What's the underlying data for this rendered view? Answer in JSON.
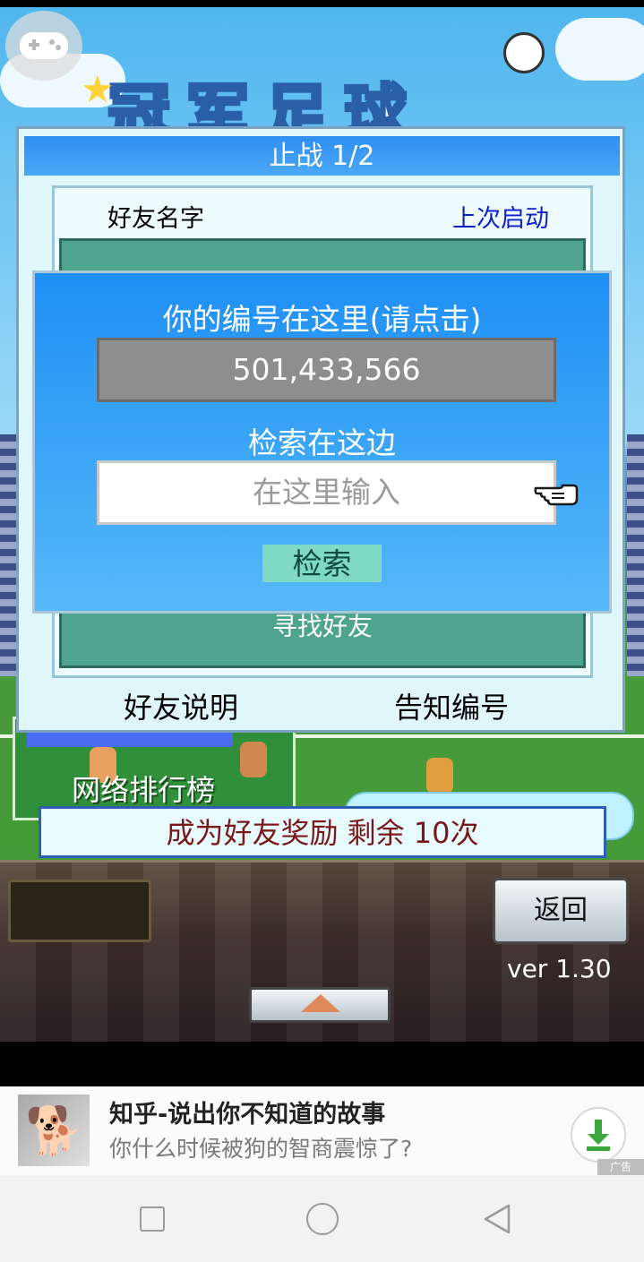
{
  "game": {
    "logo_text": "冠军足球"
  },
  "friend_window": {
    "title": "止战 1/2",
    "col_friend_name": "好友名字",
    "col_last_launch": "上次启动",
    "find_friend": "寻找好友",
    "friend_help": "好友说明",
    "notify_id": "告知编号"
  },
  "popup": {
    "your_id_label": "你的编号在这里(请点击)",
    "your_id": "501,433,566",
    "search_label": "检索在这边",
    "search_placeholder": "在这里输入",
    "search_button": "检索"
  },
  "background": {
    "ranking_label": "网络排行榜"
  },
  "reward_banner": "成为好友奖励 剩余 10次",
  "controls": {
    "back_button": "返回",
    "version": "ver 1.30"
  },
  "ad": {
    "title": "知乎-说出你不知道的故事",
    "subtitle": "你什么时候被狗的智商震惊了?",
    "tag": "广告"
  },
  "colors": {
    "popup_blue": "#1f8ff6",
    "panel_teal": "#4fa48e",
    "header_blue": "#2f8ef2",
    "last_launch_blue": "#1020c8",
    "reward_text": "#7a1818",
    "download_green": "#3aa83a"
  },
  "icons": {
    "gamepad": "gamepad-icon",
    "pointing_hand": "pointing-hand-icon",
    "up_arrow": "up-arrow-icon",
    "download": "download-icon",
    "nav_recent": "square-icon",
    "nav_home": "circle-icon",
    "nav_back": "triangle-back-icon"
  }
}
